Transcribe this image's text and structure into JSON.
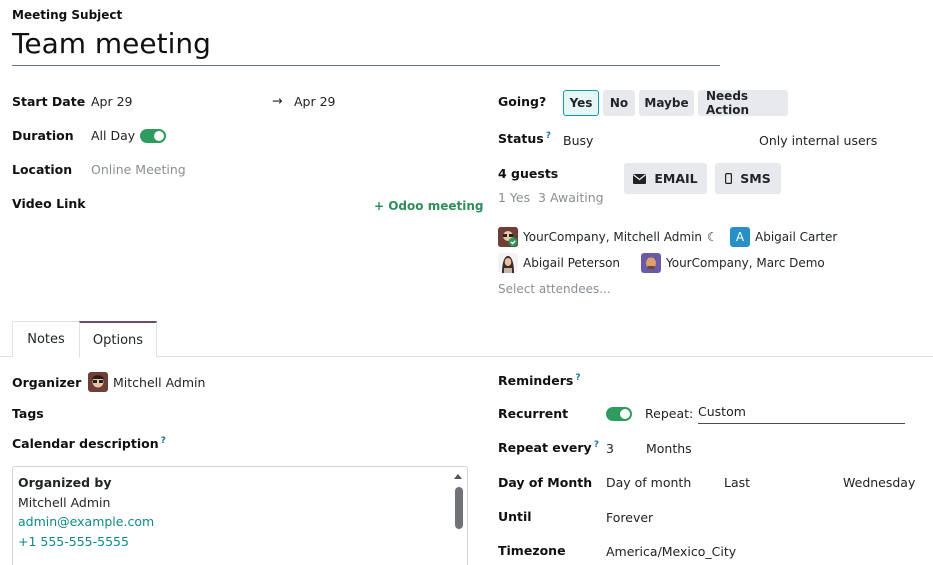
{
  "subject": {
    "label": "Meeting Subject",
    "value": "Team meeting"
  },
  "left": {
    "start_date": {
      "label": "Start Date",
      "start": "Apr 29",
      "arrow": "→",
      "end": "Apr 29"
    },
    "duration": {
      "label": "Duration",
      "value": "All Day"
    },
    "location": {
      "label": "Location",
      "placeholder": "Online Meeting"
    },
    "video_link": {
      "label": "Video Link",
      "action": "+ Odoo meeting"
    }
  },
  "right": {
    "going": {
      "label": "Going?",
      "options": [
        "Yes",
        "No",
        "Maybe",
        "Needs Action"
      ],
      "selected": "Yes"
    },
    "status": {
      "label": "Status",
      "help": "?",
      "value": "Busy",
      "privacy": "Only internal users"
    },
    "guests": {
      "label": "4 guests",
      "summary": "1 Yes  3 Awaiting",
      "email_label": "EMAIL",
      "sms_label": "SMS"
    },
    "attendees": [
      {
        "name": "YourCompany, Mitchell Admin",
        "status_icon": "☾"
      },
      {
        "name": "Abigail Carter",
        "initial": "A"
      },
      {
        "name": "Abigail Peterson"
      },
      {
        "name": "YourCompany, Marc Demo"
      }
    ],
    "attendee_placeholder": "Select attendees..."
  },
  "tabs": [
    {
      "label": "Notes"
    },
    {
      "label": "Options"
    }
  ],
  "options": {
    "organizer": {
      "label": "Organizer",
      "value": "Mitchell Admin"
    },
    "tags": {
      "label": "Tags"
    },
    "calendar_description": {
      "label": "Calendar description",
      "help": "?"
    },
    "description": {
      "heading": "Organized by",
      "name": "Mitchell Admin",
      "email": "admin@example.com",
      "phone": "+1 555-555-5555"
    },
    "reminders": {
      "label": "Reminders",
      "help": "?"
    },
    "recurrent": {
      "label": "Recurrent",
      "repeat_label": "Repeat:",
      "repeat_value": "Custom"
    },
    "repeat_every": {
      "label": "Repeat every",
      "help": "?",
      "interval": "3",
      "unit": "Months"
    },
    "day_of_month": {
      "label": "Day of Month",
      "mode": "Day of month",
      "which": "Last",
      "weekday": "Wednesday"
    },
    "until": {
      "label": "Until",
      "value": "Forever"
    },
    "timezone": {
      "label": "Timezone",
      "value": "America/Mexico_City"
    }
  },
  "colors": {
    "accent": "#0d9ea3",
    "toggle": "#2e9c5e",
    "link": "#0f8a88",
    "tab_active": "#714b67"
  }
}
